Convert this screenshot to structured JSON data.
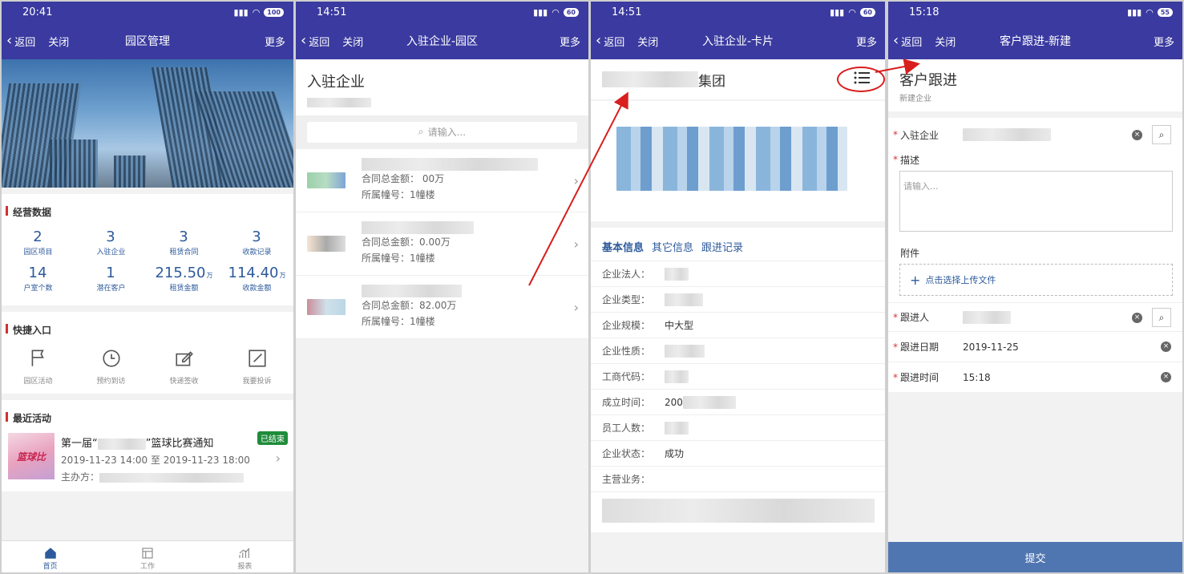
{
  "screens": {
    "s1": {
      "status_time": "20:41",
      "battery": "100",
      "nav": {
        "back": "返回",
        "close": "关闭",
        "title": "园区管理",
        "more": "更多"
      },
      "ops_title": "经营数据",
      "stats": [
        {
          "value": "2",
          "unit": "",
          "label": "园区项目"
        },
        {
          "value": "3",
          "unit": "",
          "label": "入驻企业"
        },
        {
          "value": "3",
          "unit": "",
          "label": "租赁合同"
        },
        {
          "value": "3",
          "unit": "",
          "label": "收款记录"
        },
        {
          "value": "14",
          "unit": "",
          "label": "户室个数"
        },
        {
          "value": "1",
          "unit": "",
          "label": "潜在客户"
        },
        {
          "value": "215.50",
          "unit": "万",
          "label": "租赁金额"
        },
        {
          "value": "114.40",
          "unit": "万",
          "label": "收款金额"
        }
      ],
      "quick_title": "快捷入口",
      "quick": [
        {
          "icon": "flag-icon",
          "label": "园区活动"
        },
        {
          "icon": "clock-icon",
          "label": "预约到访"
        },
        {
          "icon": "edit-icon",
          "label": "快递签收"
        },
        {
          "icon": "compose-icon",
          "label": "我要投诉"
        }
      ],
      "recent_title": "最近活动",
      "activity": {
        "thumb_text": "篮球比",
        "title_pre": "第一届“",
        "title_post": "”篮球比赛通知",
        "badge": "已结束",
        "time": "2019-11-23 14:00 至 2019-11-23 18:00",
        "host_label": "主办方："
      },
      "tabs": [
        {
          "icon": "home-icon",
          "label": "首页"
        },
        {
          "icon": "work-icon",
          "label": "工作"
        },
        {
          "icon": "report-icon",
          "label": "报表"
        }
      ]
    },
    "s2": {
      "status_time": "14:51",
      "battery": "60",
      "nav": {
        "back": "返回",
        "close": "关闭",
        "title": "入驻企业-园区",
        "more": "更多"
      },
      "header": "入驻企业",
      "search_placeholder": "请输入...",
      "items": [
        {
          "amount": "合同总金额：   00万",
          "building": "所属幢号：1幢楼"
        },
        {
          "amount": "合同总金额：0.00万",
          "building": "所属幢号：1幢楼"
        },
        {
          "amount": "合同总金额：82.00万",
          "building": "所属幢号：1幢楼"
        }
      ]
    },
    "s3": {
      "status_time": "14:51",
      "battery": "60",
      "nav": {
        "back": "返回",
        "close": "关闭",
        "title": "入驻企业-卡片",
        "more": "更多"
      },
      "company_suffix": "集团",
      "tabs": [
        "基本信息",
        "其它信息",
        "跟进记录"
      ],
      "fields": [
        {
          "label": "企业法人：",
          "value": ""
        },
        {
          "label": "企业类型：",
          "value": ""
        },
        {
          "label": "企业规模：",
          "value": "中大型"
        },
        {
          "label": "企业性质：",
          "value": ""
        },
        {
          "label": "工商代码：",
          "value": ""
        },
        {
          "label": "成立时间：",
          "value": "200"
        },
        {
          "label": "员工人数：",
          "value": ""
        },
        {
          "label": "企业状态：",
          "value": "成功"
        },
        {
          "label": "主营业务：",
          "value": ""
        }
      ]
    },
    "s4": {
      "status_time": "15:18",
      "battery": "55",
      "nav": {
        "back": "返回",
        "close": "关闭",
        "title": "客户跟进-新建",
        "more": "更多"
      },
      "header": "客户跟进",
      "subheader": "新建企业",
      "field_company": "入驻企业",
      "field_desc": "描述",
      "desc_placeholder": "请输入...",
      "field_attach": "附件",
      "upload_label": "点击选择上传文件",
      "field_follower": "跟进人",
      "field_date": "跟进日期",
      "date_value": "2019-11-25",
      "field_time": "跟进时间",
      "time_value": "15:18",
      "submit": "提交"
    }
  },
  "colors": {
    "nav": "#3a3aa0",
    "accent": "#2d5a9b",
    "required": "#d33333",
    "annotation": "#d91e1e",
    "submit": "#5076b1"
  }
}
